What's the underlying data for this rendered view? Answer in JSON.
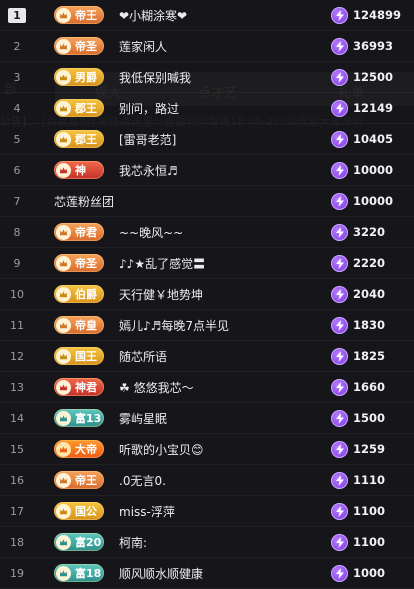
{
  "background": {
    "side_label": "部",
    "tabs": [
      "娱大",
      "点才艺",
      "礼单"
    ],
    "notice_prefix": "公告】：",
    "notice_link": "[点我复制] 关注点这里～直播时间每晚18:00-23:00欢迎大家来听"
  },
  "rows": [
    {
      "rank": "1",
      "badge": "帝王",
      "badge_style": "orange",
      "name": "❤小糊涂寒❤",
      "score": "124899"
    },
    {
      "rank": "2",
      "badge": "帝圣",
      "badge_style": "orange",
      "name": "莲家闲人",
      "score": "36993"
    },
    {
      "rank": "3",
      "badge": "男爵",
      "badge_style": "gold",
      "name": "我低保别喊我",
      "score": "12500"
    },
    {
      "rank": "4",
      "badge": "郡王",
      "badge_style": "gold",
      "name": "别问，路过",
      "score": "12149"
    },
    {
      "rank": "5",
      "badge": "郡王",
      "badge_style": "gold",
      "name": "[雷哥老范]",
      "score": "10405"
    },
    {
      "rank": "6",
      "badge": "神",
      "badge_style": "red",
      "name": "我芯永恒♬",
      "score": "10000"
    },
    {
      "rank": "7",
      "badge": "",
      "badge_style": "none",
      "name": "芯莲粉丝团",
      "score": "10000"
    },
    {
      "rank": "8",
      "badge": "帝君",
      "badge_style": "orange",
      "name": "~~晚风~~",
      "score": "3220"
    },
    {
      "rank": "9",
      "badge": "帝圣",
      "badge_style": "orange",
      "name": "♪♪★乱了感觉〓",
      "score": "2220"
    },
    {
      "rank": "10",
      "badge": "伯爵",
      "badge_style": "gold",
      "name": "天行健￥地势坤",
      "score": "2040"
    },
    {
      "rank": "11",
      "badge": "帝皇",
      "badge_style": "orange",
      "name": "嫣儿♪♬每晚7点半见",
      "score": "1830"
    },
    {
      "rank": "12",
      "badge": "国王",
      "badge_style": "gold",
      "name": "随芯所语",
      "score": "1825"
    },
    {
      "rank": "13",
      "badge": "神君",
      "badge_style": "red",
      "name": "☘ 悠悠我芯～",
      "score": "1660"
    },
    {
      "rank": "14",
      "badge": "富13",
      "badge_style": "teal",
      "name": "雾屿星眠",
      "score": "1500"
    },
    {
      "rank": "15",
      "badge": "大帝",
      "badge_style": "fire",
      "name": "听歌的小宝贝😊",
      "score": "1259"
    },
    {
      "rank": "16",
      "badge": "帝王",
      "badge_style": "orange",
      "name": ".0无言0.",
      "score": "1110"
    },
    {
      "rank": "17",
      "badge": "国公",
      "badge_style": "gold",
      "name": "miss-浮萍",
      "score": "1100"
    },
    {
      "rank": "18",
      "badge": "富20",
      "badge_style": "teal",
      "name": "柯南:",
      "score": "1100"
    },
    {
      "rank": "19",
      "badge": "富18",
      "badge_style": "teal",
      "name": "顺风顺水顺健康",
      "score": "1000"
    }
  ],
  "icons": {
    "score": "lightning-bolt-icon",
    "badge": "crown-emblem-icon"
  },
  "colors": {
    "background": "#1b1b1f",
    "score_icon": "#8a45ea",
    "badge_orange": "#e8843c",
    "badge_gold": "#e2a72a",
    "badge_red": "#d94535",
    "badge_teal": "#3ea8a2"
  }
}
